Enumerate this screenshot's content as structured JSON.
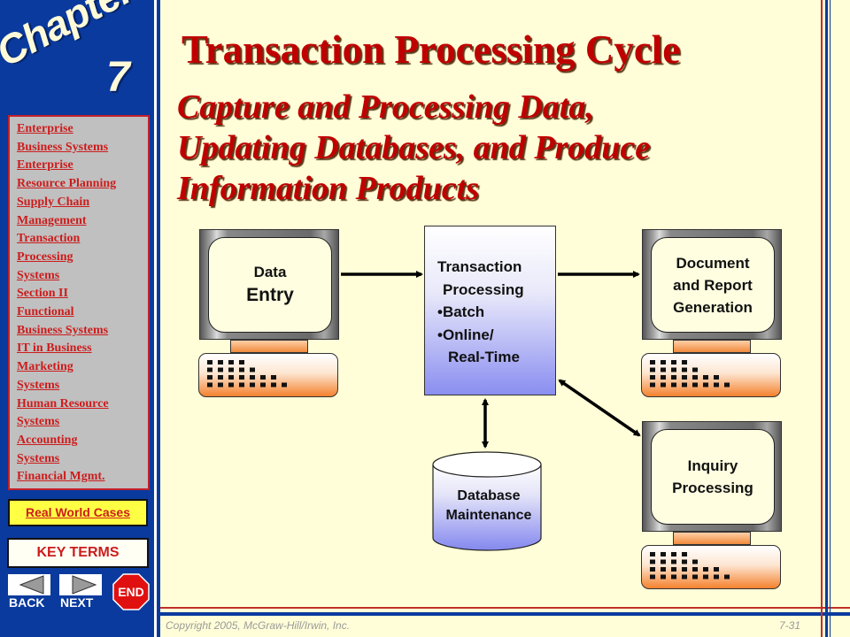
{
  "sidebar": {
    "chapter_word": "Chapter",
    "chapter_number": "7",
    "nav_links": [
      "Enterprise",
      "Business Systems",
      "Enterprise",
      "Resource Planning",
      "Supply  Chain",
      "Management",
      "Transaction",
      "Processing",
      "Systems",
      "Section II",
      "Functional",
      "Business Systems",
      "IT in Business",
      "Marketing",
      "Systems",
      "Human Resource",
      "Systems",
      "Accounting",
      "Systems",
      "Financial Mgmt."
    ],
    "real_world_cases": "Real World Cases",
    "key_terms": "KEY TERMS",
    "back_label": "BACK",
    "next_label": "NEXT",
    "end_label": "END"
  },
  "slide": {
    "title": "Transaction Processing Cycle",
    "subtitle_lines": [
      "Capture and Processing Data,",
      "Updating Databases, and Produce",
      "Information Products"
    ]
  },
  "diagram": {
    "data_entry": {
      "line1": "Data",
      "line2": "Entry"
    },
    "transaction_processing": {
      "lines": [
        "Transaction",
        " Processing",
        "•Batch",
        "•Online/",
        "  Real-Time"
      ]
    },
    "document_report": {
      "lines": [
        "Document",
        "and Report",
        "Generation"
      ]
    },
    "inquiry_processing": {
      "lines": [
        "Inquiry",
        "Processing"
      ]
    },
    "database_maintenance": {
      "lines": [
        "Database",
        "Maintenance"
      ]
    }
  },
  "footer": {
    "copyright": "Copyright 2005, McGraw-Hill/Irwin, Inc.",
    "page": "7-31"
  },
  "colors": {
    "sidebar_blue": "#0a3a9e",
    "slide_bg": "#fffed8",
    "title_red": "#c00000",
    "link_red": "#cc1c1c",
    "highlight_yellow": "#ffff44"
  }
}
